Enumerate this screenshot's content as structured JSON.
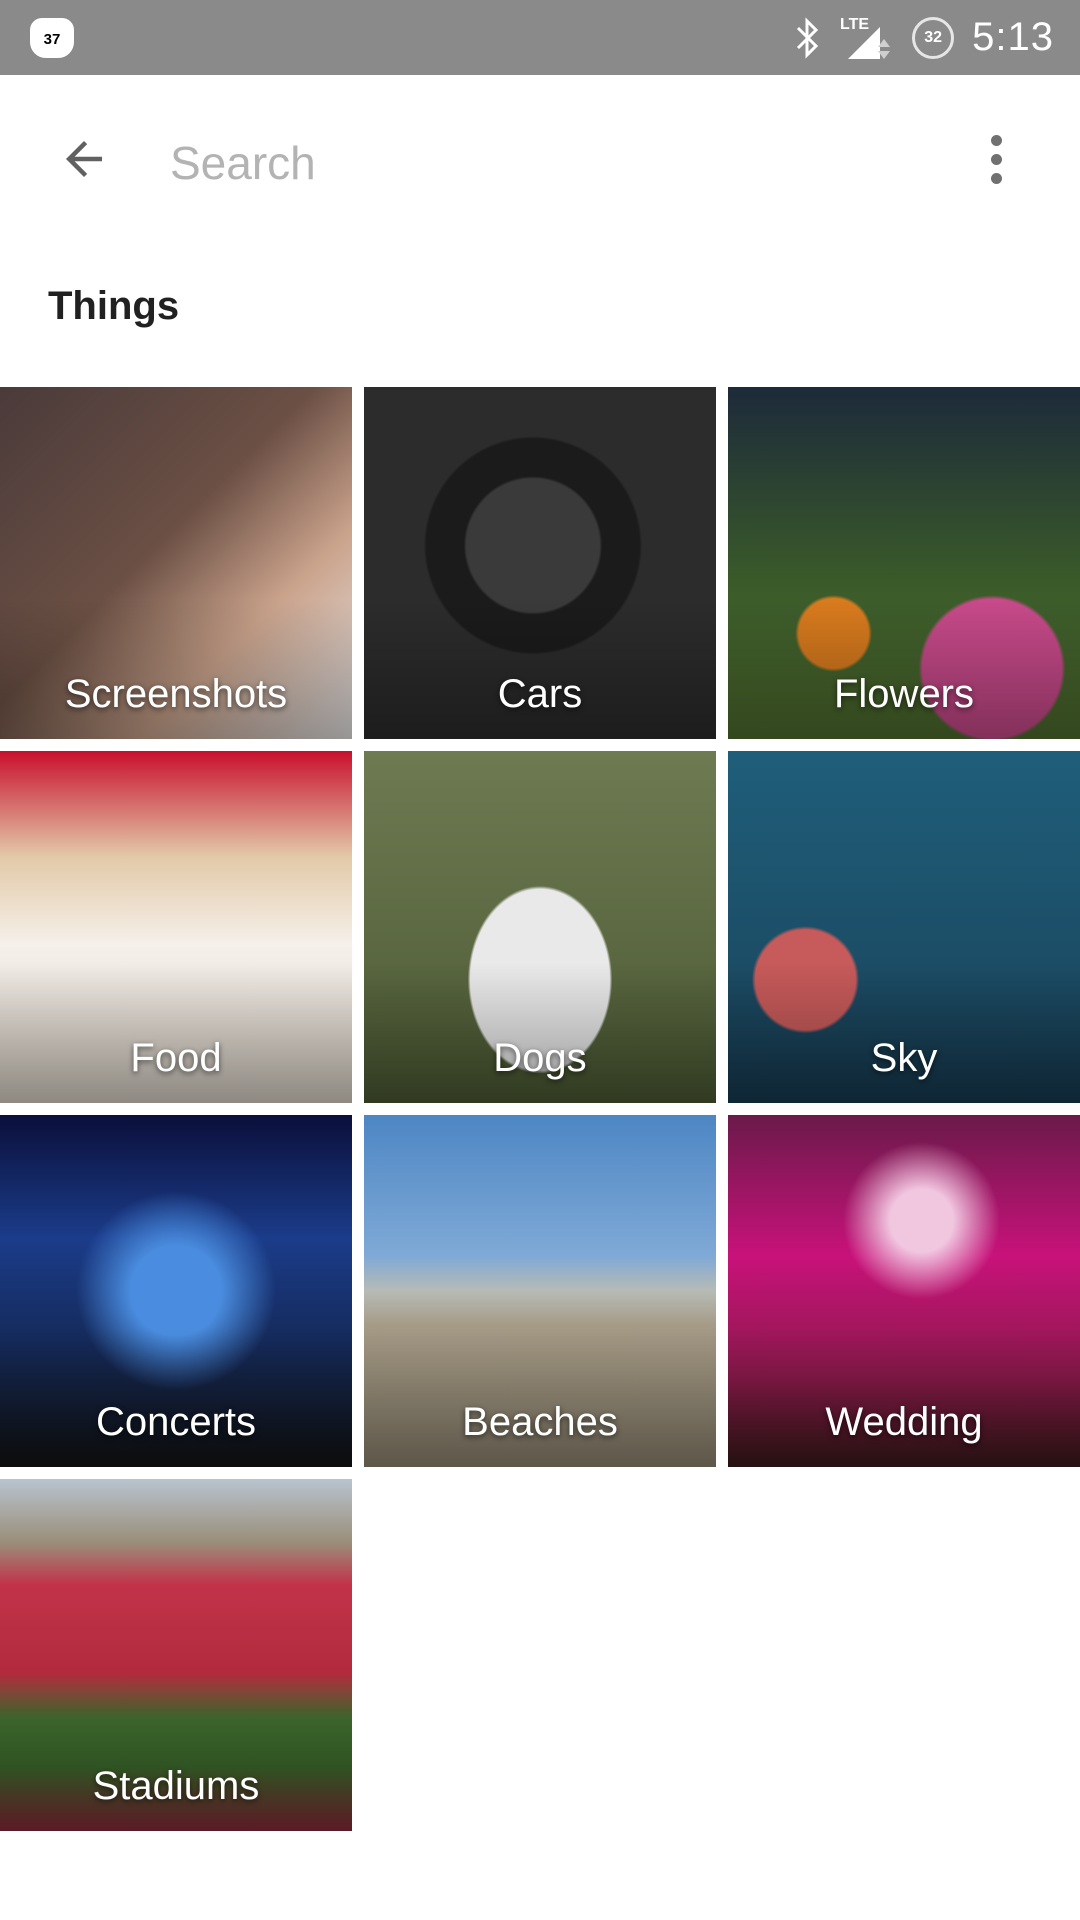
{
  "status_bar": {
    "notification_badge": "37",
    "battery_level": "32",
    "network": "LTE",
    "time": "5:13"
  },
  "app_bar": {
    "search_placeholder": "Search",
    "search_value": ""
  },
  "section": {
    "title": "Things"
  },
  "tiles": [
    {
      "label": "Screenshots"
    },
    {
      "label": "Cars"
    },
    {
      "label": "Flowers"
    },
    {
      "label": "Food"
    },
    {
      "label": "Dogs"
    },
    {
      "label": "Sky"
    },
    {
      "label": "Concerts"
    },
    {
      "label": "Beaches"
    },
    {
      "label": "Wedding"
    },
    {
      "label": "Stadiums"
    }
  ]
}
